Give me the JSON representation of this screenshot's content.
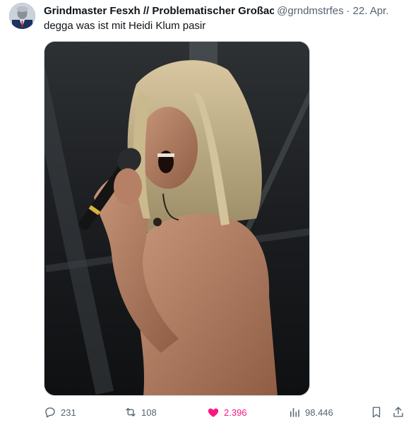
{
  "tweet": {
    "display_name": "Grindmaster Fesxh // Problematischer Großac",
    "handle": "@grndmstrfes",
    "separator": "·",
    "date": "22. Apr.",
    "text": "degga was ist mit Heidi Klum pasir",
    "media_description": "Photo of a shirtless long-haired singer shouting into a microphone on stage"
  },
  "actions": {
    "replies": "231",
    "reposts": "108",
    "likes": "2.396",
    "views": "98.446",
    "liked": true
  },
  "colors": {
    "text_primary": "#0f1419",
    "text_secondary": "#536471",
    "like_active": "#f91880",
    "border": "#cfd9de"
  },
  "icons": [
    "reply-icon",
    "repost-icon",
    "heart-icon",
    "views-icon",
    "bookmark-icon",
    "share-icon"
  ]
}
